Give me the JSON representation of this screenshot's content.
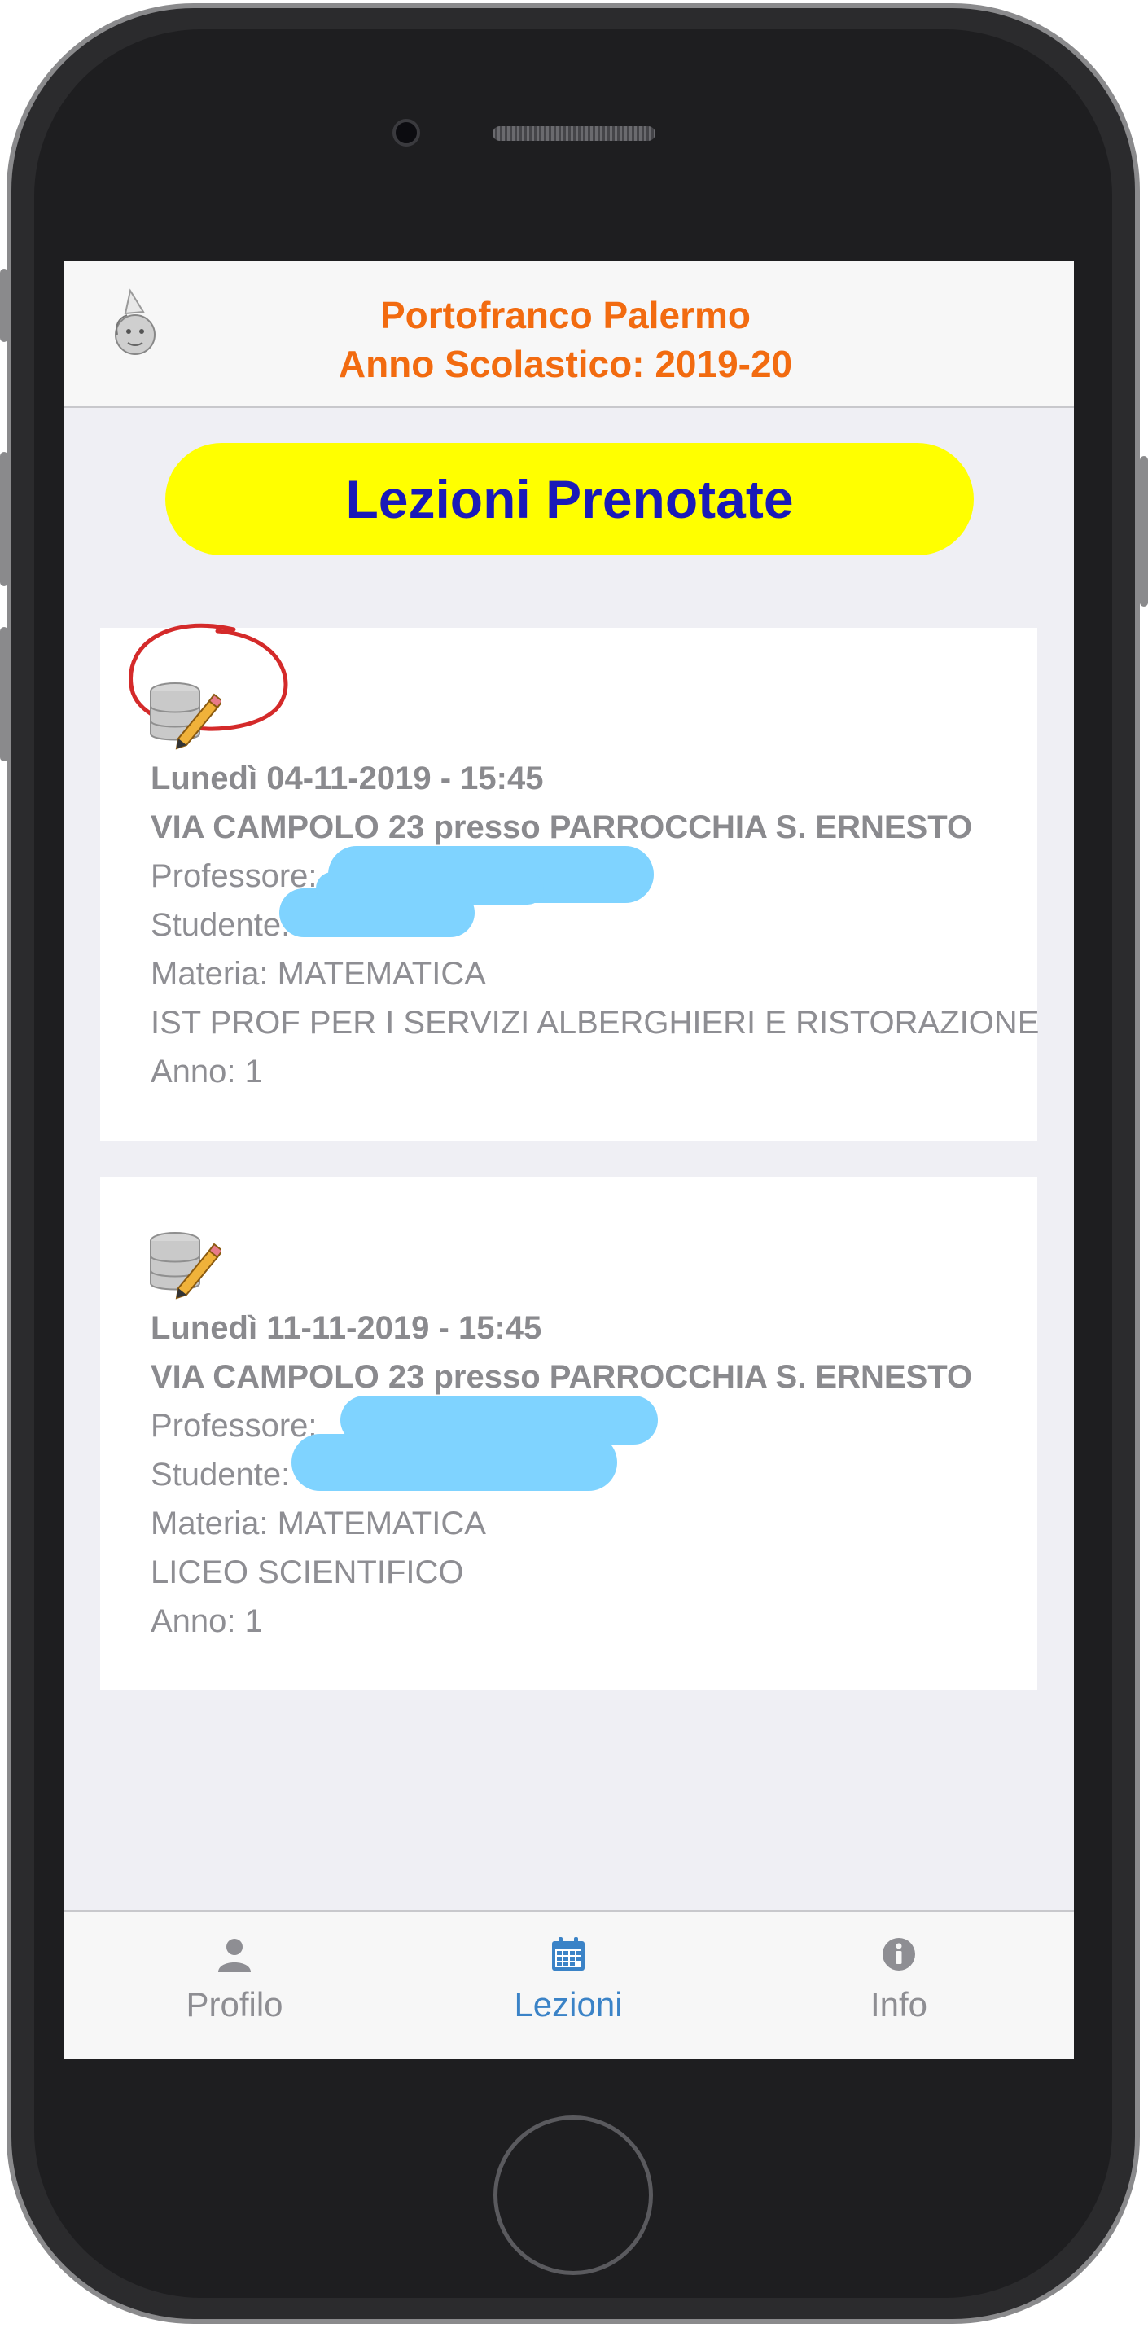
{
  "header": {
    "title_line1": "Portofranco Palermo",
    "title_line2": "Anno Scolastico: 2019-20"
  },
  "page_title": "Lezioni Prenotate",
  "lessons": [
    {
      "datetime": "Lunedì 04-11-2019 - 15:45",
      "location": "VIA CAMPOLO 23 presso PARROCCHIA S. ERNESTO",
      "professore_label": "Professore:",
      "studente_label": "Studente:",
      "materia": "Materia: MATEMATICA",
      "scuola": "IST PROF PER I SERVIZI ALBERGHIERI E RISTORAZIONE",
      "anno": "Anno: 1"
    },
    {
      "datetime": "Lunedì 11-11-2019 - 15:45",
      "location": "VIA CAMPOLO 23 presso PARROCCHIA S. ERNESTO",
      "professore_label": "Professore:",
      "studente_label": "Studente:",
      "materia": "Materia: MATEMATICA",
      "scuola": "LICEO SCIENTIFICO",
      "anno": "Anno: 1"
    }
  ],
  "tabs": [
    {
      "label": "Profilo",
      "icon": "user-icon",
      "active": false
    },
    {
      "label": "Lezioni",
      "icon": "calendar-icon",
      "active": true
    },
    {
      "label": "Info",
      "icon": "info-icon",
      "active": false
    }
  ],
  "colors": {
    "title": "#f26b10",
    "pill_bg": "#ffff00",
    "pill_text": "#1a1ab8",
    "active_tab": "#3b83c7",
    "inactive_tab": "#8e8e93",
    "redaction": "#7fd3ff",
    "annotation_circle": "#d42a2a"
  }
}
